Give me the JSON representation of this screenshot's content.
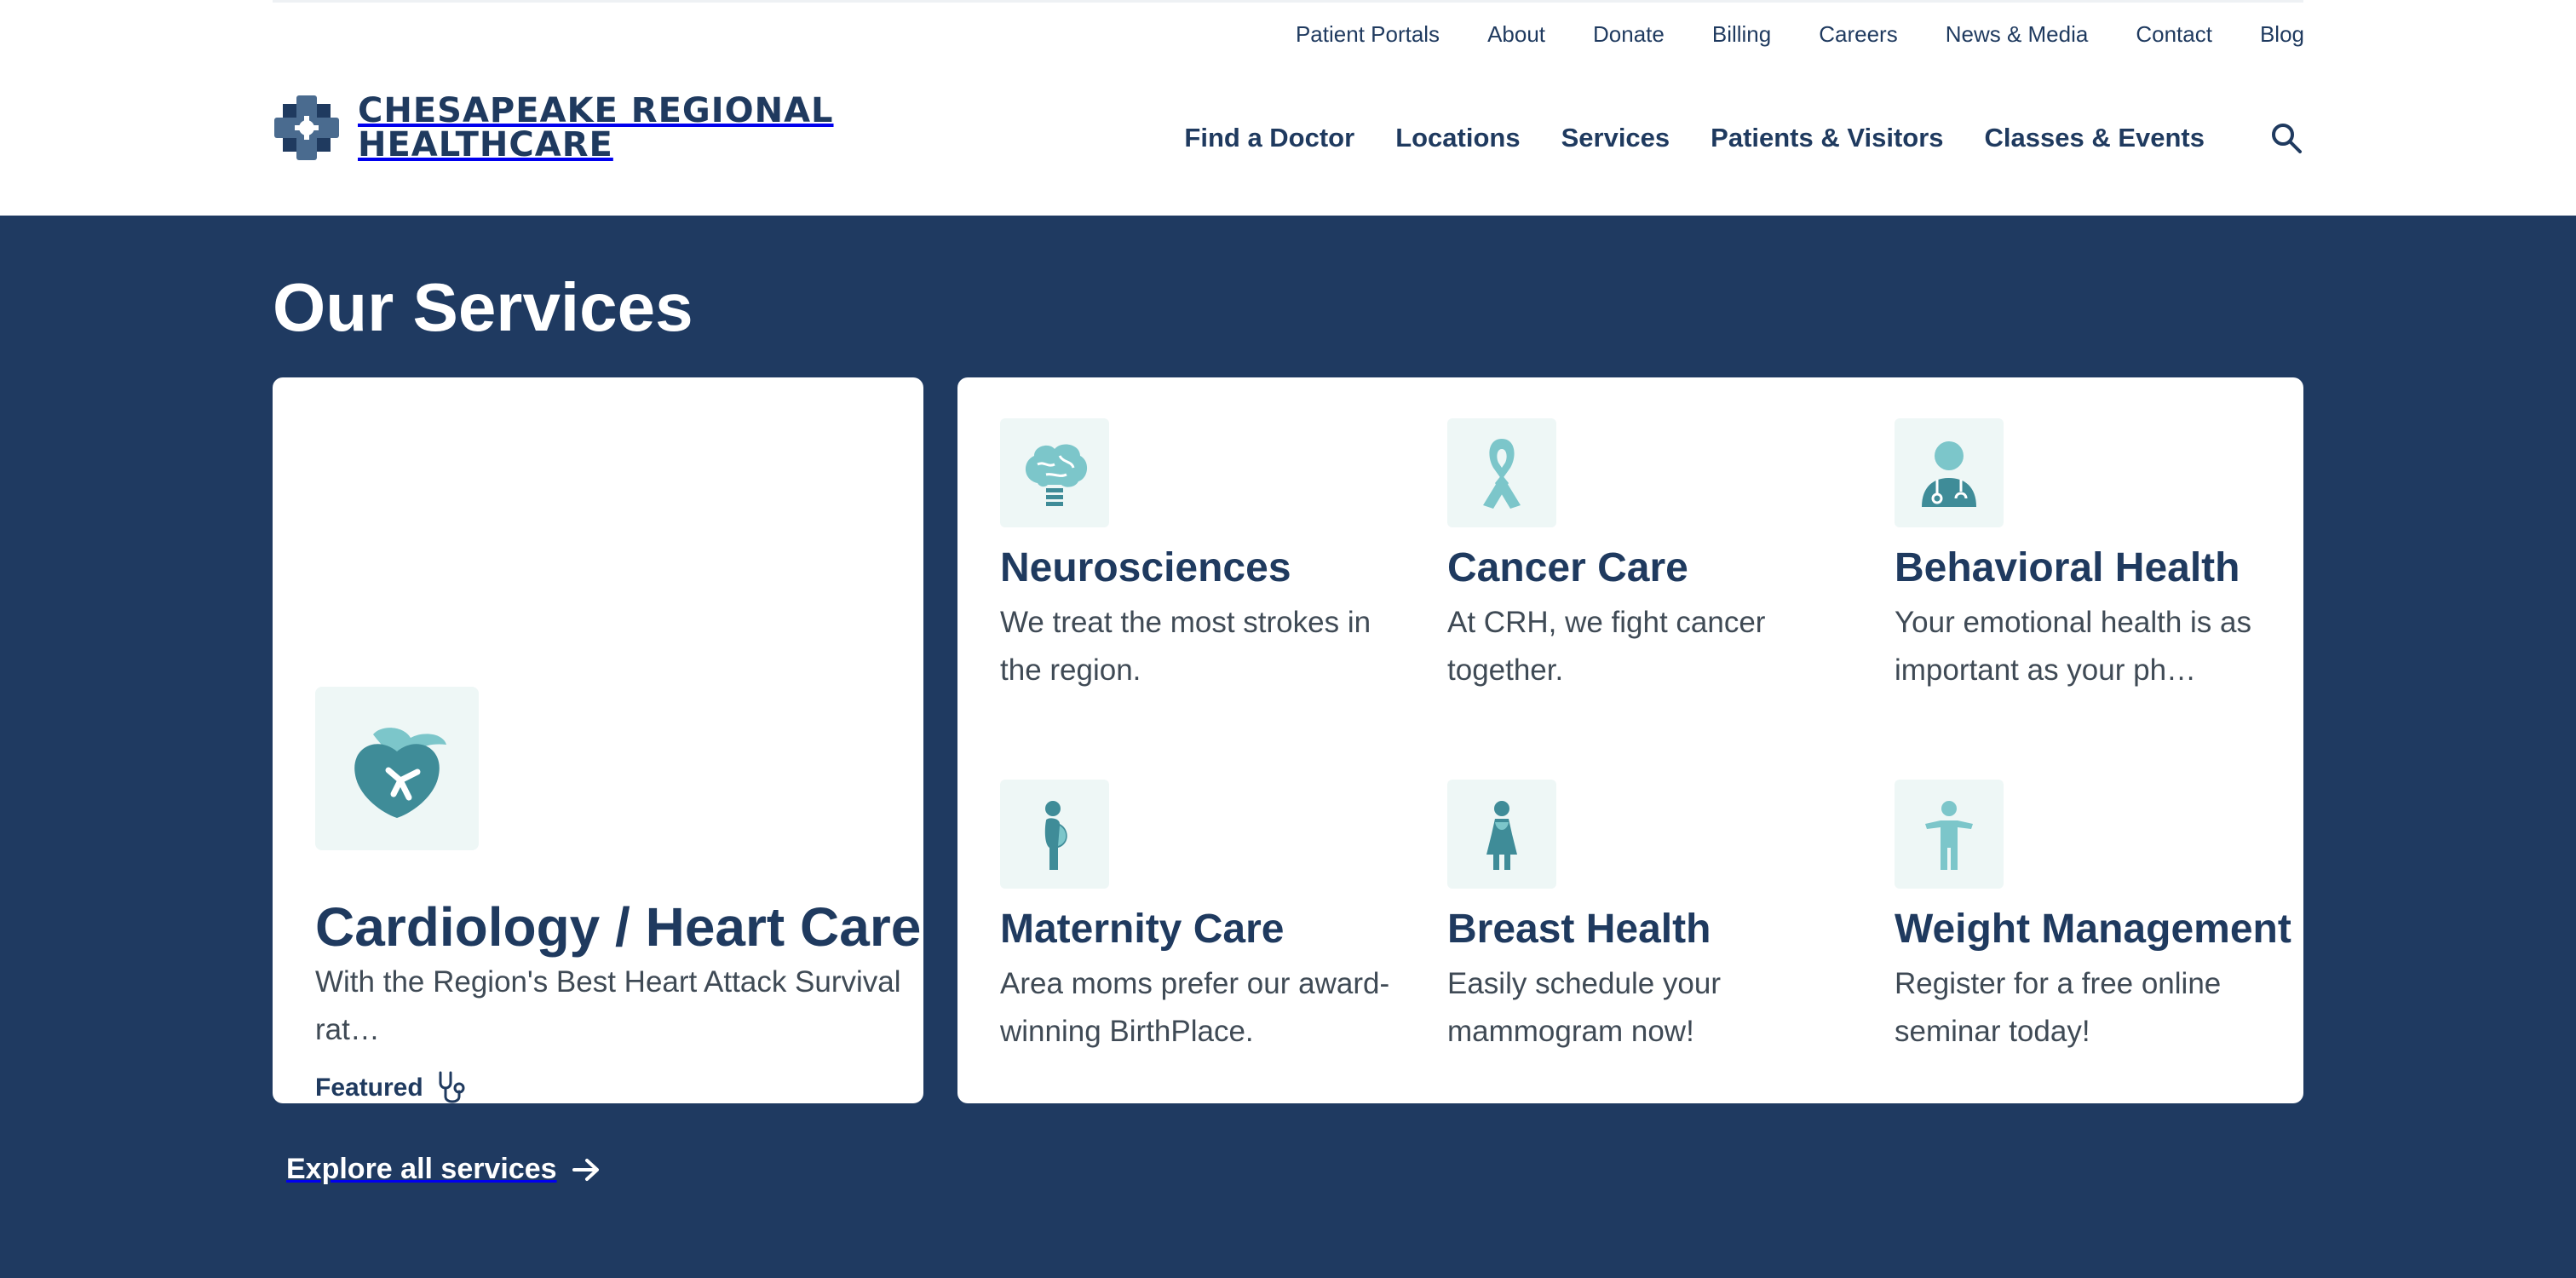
{
  "utility_nav": [
    "Patient Portals",
    "About",
    "Donate",
    "Billing",
    "Careers",
    "News & Media",
    "Contact",
    "Blog"
  ],
  "logo": {
    "line1": "CHESAPEAKE REGIONAL",
    "line2": "HEALTHCARE"
  },
  "main_nav": [
    "Find a Doctor",
    "Locations",
    "Services",
    "Patients & Visitors",
    "Classes & Events"
  ],
  "section": {
    "title": "Our Services"
  },
  "featured": {
    "title": "Cardiology / Heart Care",
    "desc": "With the Region's Best Heart Attack Survival rat…",
    "badge": "Featured"
  },
  "services": [
    {
      "title": "Neurosciences",
      "desc": "We treat the most strokes in the region.",
      "icon": "brain-icon"
    },
    {
      "title": "Cancer Care",
      "desc": "At CRH, we fight cancer together.",
      "icon": "ribbon-icon"
    },
    {
      "title": "Behavioral Health",
      "desc": "Your emotional health is as important as your ph…",
      "icon": "doctor-icon"
    },
    {
      "title": "Maternity Care",
      "desc": "Area moms prefer our award-winning BirthPlace.",
      "icon": "pregnant-woman-icon"
    },
    {
      "title": "Breast Health",
      "desc": "Easily schedule your mammogram now!",
      "icon": "woman-icon"
    },
    {
      "title": "Weight Management",
      "desc": "Register for a free online seminar today!",
      "icon": "person-icon"
    }
  ],
  "explore": {
    "label": "Explore all services"
  },
  "colors": {
    "navy": "#1f3a61",
    "text_navy": "#1f3a5f",
    "teal": "#3f8c98",
    "teal_light": "#7cc6ca",
    "icon_bg": "#eef7f6"
  }
}
